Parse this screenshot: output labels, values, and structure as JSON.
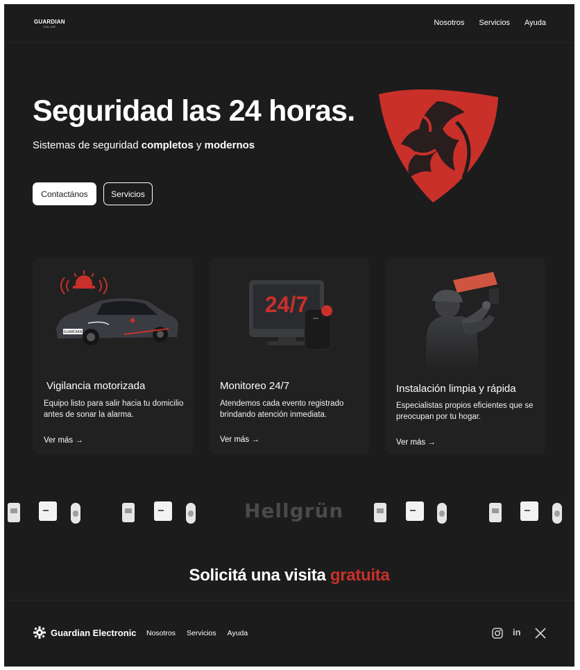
{
  "header": {
    "logo_main": "GUARDIAN",
    "logo_sub": "ONLINE",
    "nav": [
      "Nosotros",
      "Servicios",
      "Ayuda"
    ]
  },
  "hero": {
    "title": "Seguridad las 24 horas.",
    "subtitle_pre": "Sistemas de seguridad ",
    "subtitle_b1": "completos",
    "subtitle_mid": " y ",
    "subtitle_b2": "modernos",
    "btn_primary": "Contactános",
    "btn_secondary": "Servicios"
  },
  "cards": [
    {
      "title": "Vigilancia motorizada",
      "desc": "Equipo listo para salir hacia tu domicilio antes de sonar la alarma.",
      "link": "Ver más →",
      "plate": "GUARDIAN"
    },
    {
      "title": "Monitoreo 24/7",
      "desc": "Atendemos cada evento registrado brindando atención inmediata.",
      "link": "Ver más →",
      "screen_text": "24/7"
    },
    {
      "title": "Instalación limpia y rápida",
      "desc": "Especialistas propios eficientes que se preocupan por tu hogar.",
      "link": "Ver más →"
    }
  ],
  "partners": {
    "brand": "Hellgrün"
  },
  "cta": {
    "text": "Solicitá una visita ",
    "accent": "gratuita"
  },
  "footer": {
    "brand": "Guardian Electronic",
    "nav": [
      "Nosotros",
      "Servicios",
      "Ayuda"
    ],
    "social": [
      "instagram-icon",
      "linkedin-icon",
      "x-icon"
    ],
    "linkedin_text": "in"
  },
  "colors": {
    "background": "#1c1c1c",
    "card": "#212121",
    "accent": "#c9302a",
    "brand_muted": "#4a4a4a"
  }
}
